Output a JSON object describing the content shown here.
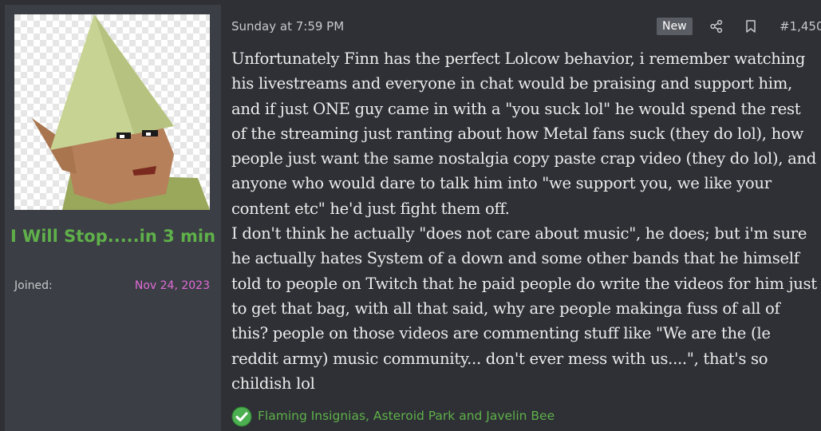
{
  "user": {
    "avatar": "gnome-avatar",
    "username": "I Will Stop.....in 3 min",
    "joined_label": "Joined:",
    "joined_date": "Nov 24, 2023"
  },
  "post": {
    "timestamp": "Sunday at 7:59 PM",
    "new_badge": "New",
    "post_number": "#1,450",
    "paragraphs": [
      "Unfortunately Finn has the perfect Lolcow behavior, i remember watching his livestreams and everyone in chat would be praising and support him, and if just ONE guy came in with a \"you suck lol\" he would spend the rest of the streaming just ranting about how Metal fans suck (they do lol), how people just want the same nostalgia copy paste crap video (they do lol), and anyone who would dare to talk him into \"we support you, we like your content etc\" he'd just fight them off.",
      "I don't think he actually \"does not care about music\", he does; but i'm sure he actually hates System of a down and some other bands that he himself told to people on Twitch that he paid people do write the videos for him just to get that bag, with all that said, why are people makinga fuss of all of this? people on those videos are commenting stuff like \"We are the (le reddit army) music community... don't ever mess with us....\", that's so childish lol"
    ],
    "reactions_text": "Flaming Insignias, Asteroid Park and Javelin Bee",
    "icons": {
      "share": "share-icon",
      "bookmark": "bookmark-icon",
      "reaction": "checkmark-reaction-icon"
    }
  },
  "colors": {
    "username": "#5fb04a",
    "joined_date": "#e06bd8",
    "reaction": "#5fb04a"
  }
}
